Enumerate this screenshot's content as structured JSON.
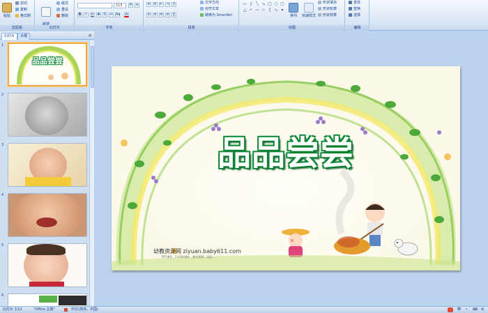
{
  "ribbon": {
    "clipboard": {
      "label": "剪贴板",
      "paste": "粘贴",
      "cut": "剪切",
      "copy": "复制",
      "format_painter": "格式刷"
    },
    "slides": {
      "label": "幻灯片",
      "new_slide": "新建\n幻灯片",
      "layout": "版式",
      "reset": "重设",
      "delete": "删除"
    },
    "font": {
      "label": "字体",
      "font_size": "115"
    },
    "paragraph": {
      "label": "段落",
      "text_direction": "文字方向",
      "align_text": "对齐文本",
      "smartart": "转换为 SmartArt"
    },
    "drawing": {
      "label": "绘图",
      "arrange": "排列",
      "quick_styles": "快速样式",
      "shape_fill": "形状填充",
      "shape_outline": "形状轮廓",
      "shape_effects": "形状效果"
    },
    "editing": {
      "label": "编辑",
      "find": "查找",
      "replace": "替换",
      "select": "选择"
    }
  },
  "panel": {
    "tabs": [
      "幻灯片",
      "大纲"
    ],
    "close": "×",
    "slides": [
      "1",
      "2",
      "3",
      "4",
      "5",
      "6"
    ]
  },
  "slide": {
    "title": "品品尝尝",
    "site": "幼教资源网 ziyuan.baby611.com",
    "sub": "PPT课件、FLASH课件、教学视频、动画……"
  },
  "thumb1": {
    "title": "品品尝尝"
  },
  "status": {
    "slide_info": "幻灯片 1/11",
    "theme": "\"Office 主题\"",
    "language": "中文(简体，中国)"
  },
  "colors": {
    "ribbon_bg": "#dbe7f5",
    "workspace_bg": "#bcd3ee",
    "title_green": "#138a3a",
    "selection_orange": "#f0a841"
  }
}
